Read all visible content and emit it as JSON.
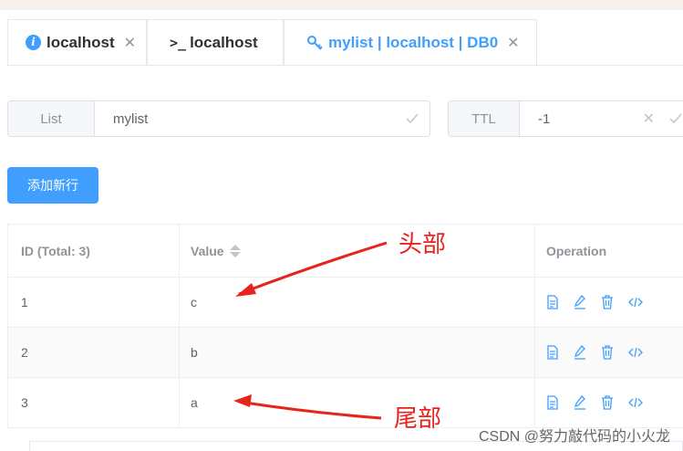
{
  "tabs": [
    {
      "label": "localhost",
      "icon": "info-icon",
      "closable": true
    },
    {
      "label": "localhost",
      "icon": "terminal-icon",
      "closable": false
    },
    {
      "label": "mylist | localhost | DB0",
      "icon": "key-icon",
      "closable": true
    }
  ],
  "key_type": {
    "label": "List",
    "value": "mylist"
  },
  "ttl": {
    "label": "TTL",
    "value": "-1"
  },
  "add_row_label": "添加新行",
  "table": {
    "headers": {
      "id": "ID (Total: 3)",
      "value": "Value",
      "operation": "Operation"
    },
    "rows": [
      {
        "id": "1",
        "value": "c"
      },
      {
        "id": "2",
        "value": "b"
      },
      {
        "id": "3",
        "value": "a"
      }
    ]
  },
  "annotations": {
    "head": "头部",
    "tail": "尾部"
  },
  "watermark": "CSDN @努力敲代码的小火龙",
  "colors": {
    "primary": "#409eff",
    "annotation": "#e8231c"
  }
}
